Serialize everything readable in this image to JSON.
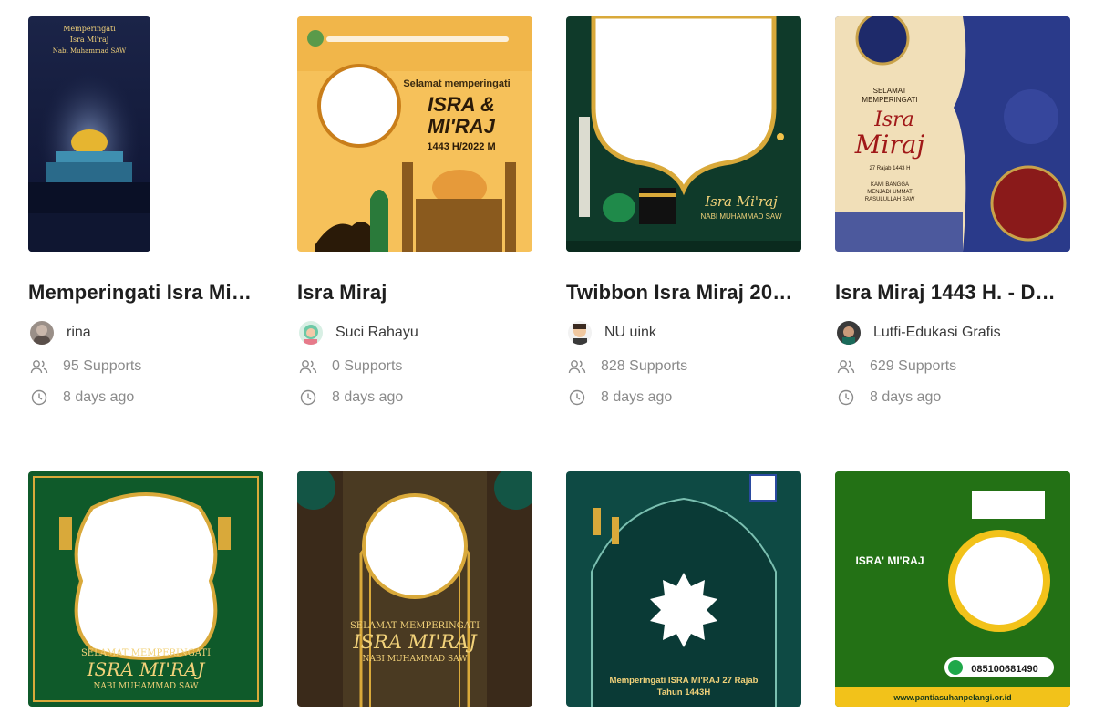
{
  "cards": [
    {
      "title": "Memperingati Isra Mi…",
      "author": "rina",
      "supports": "95 Supports",
      "time": "8 days ago",
      "thumb_text": [
        "Memperingati",
        "Isra Mi'raj",
        "Nabi Muhammad SAW"
      ]
    },
    {
      "title": "Isra Miraj",
      "author": "Suci Rahayu",
      "supports": "0 Supports",
      "time": "8 days ago",
      "thumb_text": [
        "Selamat memperingati",
        "ISRA &",
        "MI'RAJ",
        "1443 H/2022 M"
      ]
    },
    {
      "title": "Twibbon Isra Miraj 20…",
      "author": "NU uink",
      "supports": "828 Supports",
      "time": "8 days ago",
      "thumb_text": [
        "Isra Mi'raj",
        "NABI MUHAMMAD SAW"
      ]
    },
    {
      "title": "Isra Miraj 1443 H. - D…",
      "author": "Lutfi-Edukasi Grafis",
      "supports": "629 Supports",
      "time": "8 days ago",
      "thumb_text": [
        "SELAMAT",
        "MEMPERINGATI",
        "Isra",
        "Miraj",
        "27 Rajab 1443 H",
        "KAMI BANGGA",
        "MENJADI UMMAT",
        "RASULULLAH SAW"
      ]
    }
  ],
  "row2": [
    {
      "thumb_text": [
        "SELAMAT MEMPERINGATI",
        "ISRA MI'RAJ",
        "NABI MUHAMMAD SAW"
      ]
    },
    {
      "thumb_text": [
        "SELAMAT MEMPERINGATI",
        "ISRA MI'RAJ",
        "NABI MUHAMMAD SAW"
      ]
    },
    {
      "thumb_text": [
        "Memperingati ISRA MI'RAJ 27 Rajab",
        "Tahun 1443H"
      ]
    },
    {
      "thumb_text": [
        "ISRA' MI'RAJ",
        "085100681490",
        "www.pantiasuhanpelangi.or.id"
      ]
    }
  ],
  "colors": {
    "text_dark": "#1e1e1e",
    "text_muted": "#8a8a8a",
    "navy": "#1a2140",
    "yellow": "#f6c15a",
    "green": "#0f5a3a",
    "gold": "#d9a93a"
  },
  "icons": {
    "supports": "users-icon",
    "time": "clock-icon"
  }
}
